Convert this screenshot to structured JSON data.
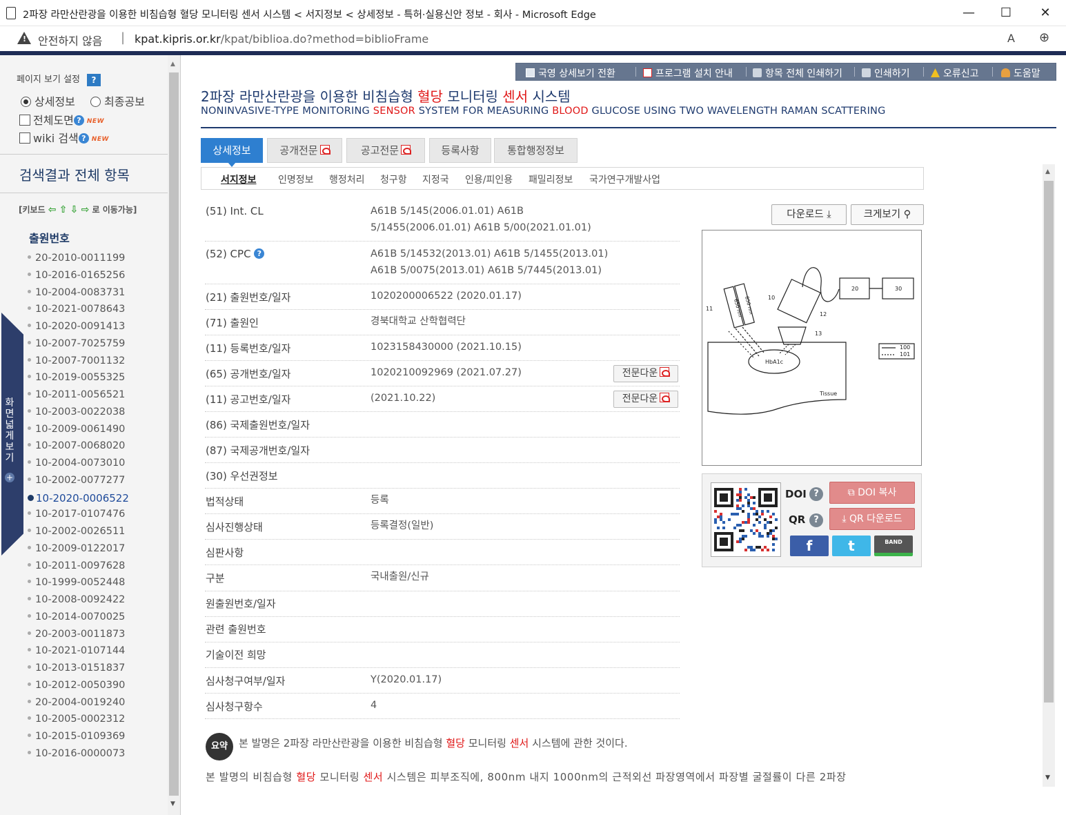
{
  "window": {
    "title": "2파장 라만산란광을 이용한 비침습형 혈당 모니터링 센서 시스템 < 서지정보 < 상세정보 - 특허·실용신안 정보 - 회사 - Microsoft Edge",
    "minimize": "—",
    "maximize": "☐",
    "close": "✕"
  },
  "address": {
    "security": "안전하지 않음",
    "url_host": "kpat.kipris.or.kr",
    "url_path": "/kpat/biblioa.do?method=biblioFrame",
    "read_aloud": "A",
    "zoom_icon": "⊕"
  },
  "sidebar": {
    "page_view_setting": "페이지 보기 설정",
    "help_q": "?",
    "radio_detail": "상세정보",
    "radio_final": "최종공보",
    "check_full_drawing": "전체도면",
    "check_wiki": "wiki 검색",
    "new_badge": "NEW",
    "section_title": "검색결과 전체 항목",
    "keyboard_hint_start": "[키보드",
    "keyboard_hint_end": "로 이동가능]",
    "app_number_heading": "출원번호",
    "expand_label": "화면넓게보기",
    "expand_plus": "+",
    "app_numbers": [
      "20-2010-0011199",
      "10-2016-0165256",
      "10-2004-0083731",
      "10-2021-0078643",
      "10-2020-0091413",
      "10-2007-7025759",
      "10-2007-7001132",
      "10-2019-0055325",
      "10-2011-0056521",
      "10-2003-0022038",
      "10-2009-0061490",
      "10-2007-0068020",
      "10-2004-0073010",
      "10-2002-0077277",
      "10-2020-0006522",
      "10-2017-0107476",
      "10-2002-0026511",
      "10-2009-0122017",
      "10-2011-0097628",
      "10-1999-0052448",
      "10-2008-0092422",
      "10-2014-0070025",
      "20-2003-0011873",
      "10-2021-0107144",
      "10-2013-0151837",
      "10-2012-0050390",
      "20-2004-0019240",
      "10-2005-0002312",
      "10-2015-0109369",
      "10-2016-0000073"
    ],
    "selected_index": 14
  },
  "toolbar": {
    "english_view": "국영 상세보기 전환",
    "program_install": "프로그램 설치 안내",
    "print_all": "항목 전체 인쇄하기",
    "print": "인쇄하기",
    "report_error": "오류신고",
    "help": "도움말"
  },
  "patent": {
    "title_pre": "2파장 라만산란광을 이용한 비침습형 ",
    "title_hl1": "혈당",
    "title_mid": " 모니터링 ",
    "title_hl2": "센서",
    "title_post": " 시스템",
    "en_pre": "NONINVASIVE-TYPE MONITORING ",
    "en_hl1": "SENSOR",
    "en_mid": " SYSTEM FOR MEASURING ",
    "en_hl2": "BLOOD",
    "en_post": " GLUCOSE USING TWO WAVELENGTH RAMAN SCATTERING"
  },
  "tabs": {
    "detail": "상세정보",
    "pub_full": "공개전문",
    "ann_full": "공고전문",
    "registration": "등록사항",
    "admin": "통합행정정보"
  },
  "subtabs": [
    "서지정보",
    "인명정보",
    "행정처리",
    "청구항",
    "지정국",
    "인용/피인용",
    "패밀리정보",
    "국가연구개발사업"
  ],
  "biblio": {
    "ipc_label": "(51) Int. CL",
    "ipc_value": "A61B 5/145(2006.01.01) A61B 5/1455(2006.01.01) A61B 5/00(2021.01.01)",
    "cpc_label": "(52) CPC",
    "cpc_value": "A61B 5/14532(2013.01) A61B 5/1455(2013.01) A61B 5/0075(2013.01) A61B 5/7445(2013.01)",
    "app_label": "(21) 출원번호/일자",
    "app_value": "1020200006522 (2020.01.17)",
    "applicant_label": "(71) 출원인",
    "applicant_value": "경북대학교 산학협력단",
    "reg_label": "(11) 등록번호/일자",
    "reg_value": "1023158430000 (2021.10.15)",
    "pub_label": "(65) 공개번호/일자",
    "pub_value": "1020210092969 (2021.07.27)",
    "ann_label": "(11) 공고번호/일자",
    "ann_value": "(2021.10.22)",
    "intl_app_label": "(86) 국제출원번호/일자",
    "intl_pub_label": "(87) 국제공개번호/일자",
    "priority_label": "(30) 우선권정보",
    "legal_label": "법적상태",
    "legal_value": "등록",
    "exam_label": "심사진행상태",
    "exam_value": "등록결정(일반)",
    "trial_label": "심판사항",
    "category_label": "구분",
    "category_value": "국내출원/신규",
    "orig_label": "원출원번호/일자",
    "related_label": "관련 출원번호",
    "transfer_label": "기술이전 희망",
    "exam_req_label": "심사청구여부/일자",
    "exam_req_value": "Y(2020.01.17)",
    "claims_label": "심사청구항수",
    "claims_value": "4",
    "full_download": "전문다운"
  },
  "image_panel": {
    "download": "다운로드",
    "enlarge": "크게보기",
    "labels": {
      "n11": "11",
      "n10": "10",
      "n12": "12",
      "n13": "13",
      "n20": "20",
      "n30": "30",
      "n100": "100",
      "n101": "101",
      "hba1c": "HbA1c",
      "tissue": "Tissue",
      "nm850": "850 nm",
      "nm650": "650 nm"
    }
  },
  "share": {
    "doi": "DOI",
    "qr": "QR",
    "q": "?",
    "doi_copy": "DOI 복사",
    "qr_download": "QR 다운로드",
    "facebook": "f",
    "twitter": "t",
    "band": "BAND"
  },
  "summary": {
    "icon": "요약",
    "line1_pre": "본 발명은 2파장 라만산란광을 이용한 비침습형 ",
    "line1_hl1": "혈당",
    "line1_mid": " 모니터링 ",
    "line1_hl2": "센서",
    "line1_post": " 시스템에 관한 것이다.",
    "line2_pre": "본 발명의 비침습형 ",
    "line2_hl1": "혈당",
    "line2_mid": " 모니터링 ",
    "line2_hl2": "센서",
    "line2_post": " 시스템은 피부조직에, 800nm 내지 1000nm의 근적외선 파장영역에서 파장별 굴절률이 다른 2파장"
  },
  "colors": {
    "accent": "#2e7fd0",
    "navy": "#1e3a6e",
    "highlight": "#e01818",
    "toolbar": "#66768f"
  }
}
